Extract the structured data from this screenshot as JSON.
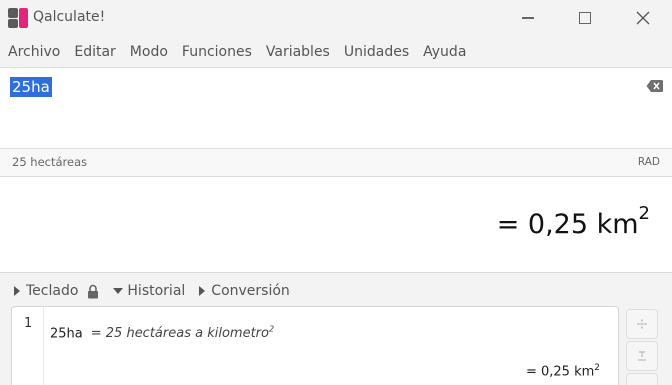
{
  "window": {
    "title": "Qalculate!"
  },
  "menu": {
    "items": [
      "Archivo",
      "Editar",
      "Modo",
      "Funciones",
      "Variables",
      "Unidades",
      "Ayuda"
    ]
  },
  "expression": {
    "value": "25ha"
  },
  "status": {
    "parsed": "25 hectáreas",
    "angle_mode": "RAD"
  },
  "result": {
    "prefix": "= 0,25 km",
    "exponent": "2"
  },
  "expanders": {
    "keypad": "Teclado",
    "history": "Historial",
    "conversion": "Conversión"
  },
  "history": {
    "entries": [
      {
        "index": "1",
        "input": "25ha",
        "parsed": "= 25 hectáreas a kilometro",
        "parsed_exponent": "2",
        "result": "= 0,25 km",
        "result_exponent": "2"
      }
    ]
  },
  "colors": {
    "selection": "#2e6fdc",
    "accent": "#e0257a"
  },
  "icons": {
    "app": "qalculate-app-icon",
    "clear": "backspace-clear-icon",
    "lock": "lock-icon"
  }
}
